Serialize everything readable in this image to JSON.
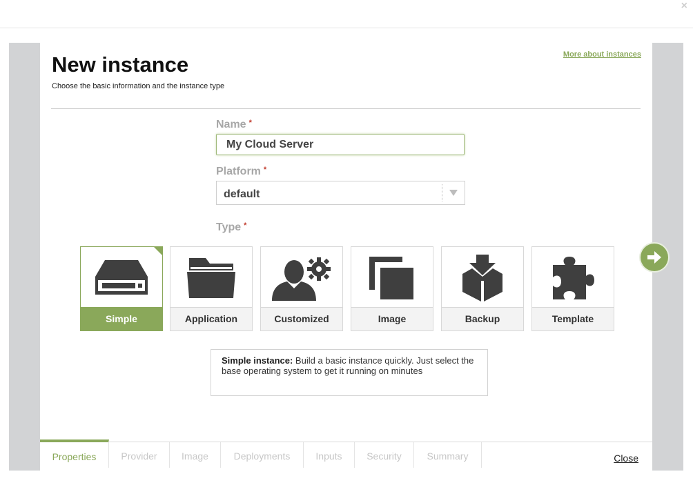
{
  "window": {
    "close_glyph": "×"
  },
  "header": {
    "title": "New instance",
    "subtitle": "Choose the basic information and the instance type",
    "more_link": "More about instances"
  },
  "form": {
    "name_label": "Name",
    "name_value": "My Cloud Server",
    "platform_label": "Platform",
    "platform_value": "default",
    "type_label": "Type",
    "required_mark": "*"
  },
  "types": [
    {
      "label": "Simple",
      "icon": "server-drive-icon",
      "selected": true
    },
    {
      "label": "Application",
      "icon": "folder-icon",
      "selected": false
    },
    {
      "label": "Customized",
      "icon": "user-gear-icon",
      "selected": false
    },
    {
      "label": "Image",
      "icon": "copy-squares-icon",
      "selected": false
    },
    {
      "label": "Backup",
      "icon": "box-download-icon",
      "selected": false
    },
    {
      "label": "Template",
      "icon": "puzzle-piece-icon",
      "selected": false
    }
  ],
  "description": {
    "bold": "Simple instance:",
    "text": " Build a basic instance quickly. Just select the base operating system to get it running on minutes"
  },
  "footer": {
    "tabs": [
      "Properties",
      "Provider",
      "Image",
      "Deployments",
      "Inputs",
      "Security",
      "Summary"
    ],
    "active_tab": "Properties",
    "close_label": "Close"
  },
  "colors": {
    "accent": "#8aa85a",
    "icon": "#3f3f3f",
    "backdrop": "#d2d3d5"
  }
}
